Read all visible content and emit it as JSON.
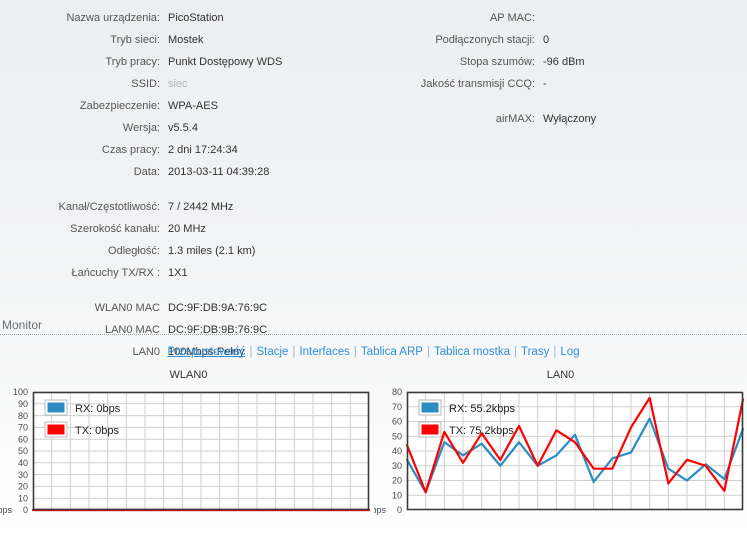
{
  "status": {
    "left_column": [
      {
        "label": "Nazwa urządzenia:",
        "value": "PicoStation",
        "muted": false,
        "gap": false
      },
      {
        "label": "Tryb sieci:",
        "value": "Mostek",
        "muted": false,
        "gap": false
      },
      {
        "label": "Tryb pracy:",
        "value": "Punkt Dostępowy WDS",
        "muted": false,
        "gap": false
      },
      {
        "label": "SSID:",
        "value": "siec",
        "muted": true,
        "gap": false
      },
      {
        "label": "Zabezpieczenie:",
        "value": "WPA-AES",
        "muted": false,
        "gap": false
      },
      {
        "label": "Wersja:",
        "value": "v5.5.4",
        "muted": false,
        "gap": false
      },
      {
        "label": "Czas pracy:",
        "value": "2 dni 17:24:34",
        "muted": false,
        "gap": false
      },
      {
        "label": "Data:",
        "value": "2013-03-11 04:39:28",
        "muted": false,
        "gap": false
      },
      {
        "label": "Kanał/Częstotliwość:",
        "value": "7 / 2442 MHz",
        "muted": false,
        "gap": true
      },
      {
        "label": "Szerokość kanału:",
        "value": "20 MHz",
        "muted": false,
        "gap": false
      },
      {
        "label": "Odległość:",
        "value": "1.3 miles (2.1 km)",
        "muted": false,
        "gap": false
      },
      {
        "label": "Łańcuchy TX/RX :",
        "value": "1X1",
        "muted": false,
        "gap": false
      },
      {
        "label": "WLAN0 MAC",
        "value": "DC:9F:DB:9A:76:9C",
        "muted": false,
        "gap": true
      },
      {
        "label": "LAN0 MAC",
        "value": "DC:9F:DB:9B:76:9C",
        "muted": false,
        "gap": false
      },
      {
        "label": "LAN0",
        "value": "100Mbps-Pełny",
        "muted": false,
        "gap": false
      }
    ],
    "right_column": [
      {
        "label": "AP MAC:",
        "value": "",
        "muted": false,
        "gap": false
      },
      {
        "label": "Podłączonych stacji:",
        "value": "0",
        "muted": false,
        "gap": false
      },
      {
        "label": "Stopa szumów:",
        "value": "-96 dBm",
        "muted": false,
        "gap": false
      },
      {
        "label": "Jakość transmisji CCQ:",
        "value": "-",
        "muted": false,
        "gap": false
      },
      {
        "label": "airMAX:",
        "value": "Wyłączony",
        "muted": false,
        "gap": true
      }
    ]
  },
  "monitor": {
    "section_title": "Monitor",
    "links": [
      {
        "label": "Przepustowość",
        "active": true
      },
      {
        "label": "Stacje",
        "active": false
      },
      {
        "label": "Interfaces",
        "active": false
      },
      {
        "label": "Tablica ARP",
        "active": false
      },
      {
        "label": "Tablica mostka",
        "active": false
      },
      {
        "label": "Trasy",
        "active": false
      },
      {
        "label": "Log",
        "active": false
      }
    ],
    "separator": "|"
  },
  "colors": {
    "rx": "#2b8cc4",
    "tx": "#ff0000",
    "grid": "#cfcfcf",
    "frame": "#3a3a3a",
    "link": "#2f8fd8"
  },
  "chart_data": [
    {
      "type": "line",
      "title": "WLAN0",
      "xlabel": "",
      "ylabel": "bps",
      "ylim": [
        0,
        100
      ],
      "yticks": [
        0,
        10,
        20,
        30,
        40,
        50,
        60,
        70,
        80,
        90,
        100
      ],
      "grid": true,
      "legend_position": "top-left",
      "unit_label": "bps",
      "legend": [
        {
          "name": "RX",
          "label": "RX: 0bps",
          "color": "#2b8cc4"
        },
        {
          "name": "TX",
          "label": "TX: 0bps",
          "color": "#ff0000"
        }
      ],
      "series": [
        {
          "name": "RX",
          "color": "#2b8cc4",
          "values": [
            0,
            0,
            0,
            0,
            0,
            0,
            0,
            0,
            0,
            0,
            0,
            0,
            0,
            0,
            0,
            0,
            0,
            0,
            0,
            0,
            0,
            0,
            0,
            0,
            0,
            0,
            0,
            0,
            0,
            0,
            0,
            0,
            0
          ]
        },
        {
          "name": "TX",
          "color": "#ff0000",
          "values": [
            0,
            0,
            0,
            0,
            0,
            0,
            0,
            0,
            0,
            0,
            0,
            0,
            0,
            0,
            0,
            0,
            0,
            0,
            0,
            0,
            0,
            0,
            0,
            0,
            0,
            0,
            0,
            0,
            0,
            0,
            0,
            0,
            0
          ]
        }
      ]
    },
    {
      "type": "line",
      "title": "LAN0",
      "xlabel": "",
      "ylabel": "kbps",
      "ylim": [
        0,
        80
      ],
      "yticks": [
        0,
        10,
        20,
        30,
        40,
        50,
        60,
        70,
        80
      ],
      "grid": true,
      "legend_position": "top-left",
      "unit_label": "kbps",
      "legend": [
        {
          "name": "RX",
          "label": "RX: 55.2kbps",
          "color": "#2b8cc4"
        },
        {
          "name": "TX",
          "label": "TX: 75.2kbps",
          "color": "#ff0000"
        }
      ],
      "series": [
        {
          "name": "RX",
          "color": "#2b8cc4",
          "values": [
            34,
            12,
            46,
            37,
            45,
            30,
            46,
            30,
            37,
            51,
            19,
            35,
            39,
            62,
            28,
            20,
            31,
            21,
            55
          ]
        },
        {
          "name": "TX",
          "color": "#ff0000",
          "values": [
            44,
            12,
            53,
            32,
            52,
            34,
            57,
            30,
            54,
            46,
            28,
            28,
            56,
            76,
            18,
            34,
            30,
            13,
            75
          ]
        }
      ]
    }
  ]
}
